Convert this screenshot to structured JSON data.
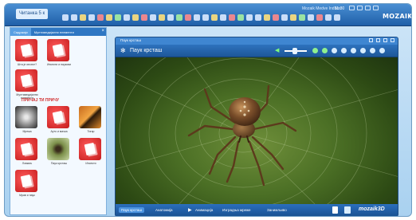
{
  "topbar": {
    "app_tab": "Читанка 5 к",
    "user_name": "Mozaik Medve Indbox",
    "clock": "11:30",
    "logo": "MOZAIK"
  },
  "left_panel": {
    "tabs": [
      "Садржаји",
      "Мултимедијални елементи"
    ],
    "section_title": "ПРИЧАЈ ТИ ПРИЧУ",
    "top_items": [
      {
        "label": "Шта је инсект?",
        "thumb": "red"
      },
      {
        "label": "Инсекти и паукови",
        "thumb": "red"
      },
      {
        "label": "",
        "thumb": "none"
      },
      {
        "label": "Мултимедијални елементи",
        "thumb": "red"
      }
    ],
    "items": [
      {
        "label": "Мрежа",
        "thumb": "web"
      },
      {
        "label": "Ауто и мачка",
        "thumb": "red"
      },
      {
        "label": "Тигар",
        "thumb": "tiger"
      },
      {
        "label": "Ловкињ",
        "thumb": "red"
      },
      {
        "label": "Паук крсташ",
        "thumb": "spider"
      },
      {
        "label": "Инсекти",
        "thumb": "red"
      },
      {
        "label": "Мрав и паук",
        "thumb": "red"
      }
    ]
  },
  "content_window": {
    "tab_label": "Паук крсташ",
    "title": "Паук крсташ",
    "volume_level": 0.45,
    "bottom_bar": {
      "items": [
        "Паук крсташ",
        "Анатомија",
        "Анимација",
        "Изградња мреже",
        "Занимљиво"
      ],
      "brand": "mozaik3D"
    }
  },
  "colors": {
    "toolbar_blue": "#1f5fa8",
    "section_red": "#d12b2b",
    "spider_brown": "#6b4324"
  }
}
